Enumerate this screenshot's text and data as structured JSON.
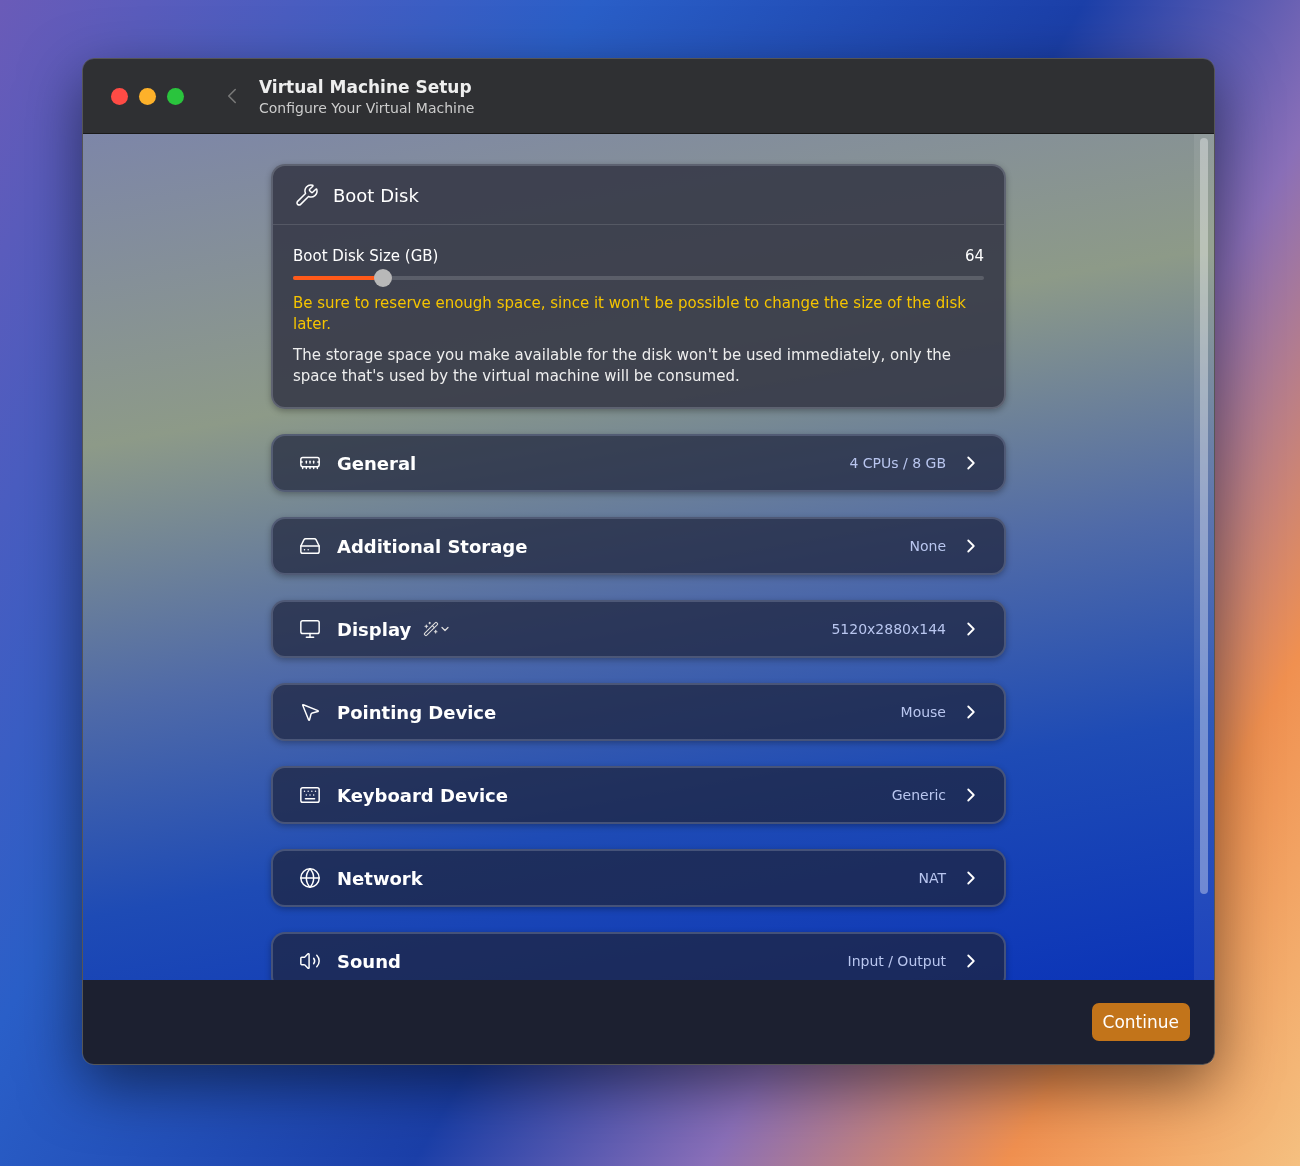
{
  "window": {
    "title": "Virtual Machine Setup",
    "subtitle": "Configure Your Virtual Machine"
  },
  "boot_disk": {
    "title": "Boot Disk",
    "slider": {
      "label": "Boot Disk Size (GB)",
      "reading": "64",
      "level": 0.13
    },
    "warning": "Be sure to reserve enough space, since it won't be possible to change the size of the disk later.",
    "note": "The storage space you make available for the disk won't be used immediately, only the space that's used by the virtual machine will be consumed."
  },
  "settings": [
    {
      "label": "General",
      "value": "4 CPUs / 8 GB"
    },
    {
      "label": "Additional Storage",
      "value": "None"
    },
    {
      "label": "Display",
      "value": "5120x2880x144"
    },
    {
      "label": "Pointing Device",
      "value": "Mouse"
    },
    {
      "label": "Keyboard Device",
      "value": "Generic"
    },
    {
      "label": "Network",
      "value": "NAT"
    },
    {
      "label": "Sound",
      "value": "Input / Output"
    }
  ],
  "footer": {
    "button": "Continue"
  }
}
